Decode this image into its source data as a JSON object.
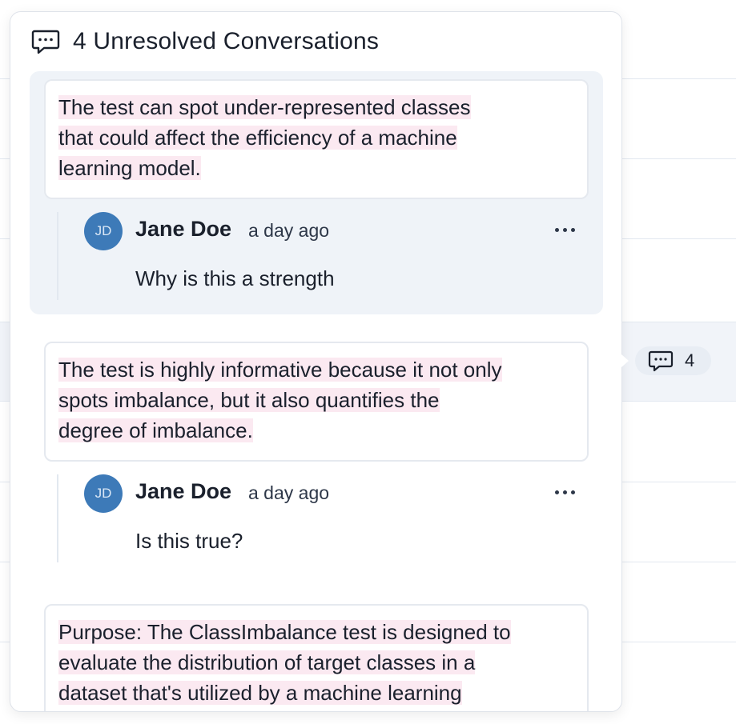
{
  "header": {
    "title": "4 Unresolved Conversations",
    "icon": "comment-icon"
  },
  "side_badge": {
    "count": "4",
    "icon": "comment-icon"
  },
  "threads": [
    {
      "quote_lines": [
        "The test can spot under-represented classes",
        "that could affect the efficiency of a machine",
        "learning model. "
      ],
      "comment": {
        "avatar_initials": "JD",
        "author": "Jane Doe",
        "time": "a day ago",
        "text": "Why is this a strength"
      }
    },
    {
      "quote_lines": [
        "The test is highly informative because it not only",
        "spots imbalance, but it also quantifies the",
        "degree of imbalance. "
      ],
      "comment": {
        "avatar_initials": "JD",
        "author": "Jane Doe",
        "time": "a day ago",
        "text": "Is this true?"
      }
    },
    {
      "quote_lines": [
        "Purpose: The ClassImbalance test is designed to",
        "evaluate the distribution of target classes in a",
        "dataset that's utilized by a machine learning"
      ]
    }
  ],
  "colors": {
    "highlight": "#fbe9f1",
    "avatar": "#3d7ab8",
    "active_thread_bg": "#eff3f8"
  }
}
